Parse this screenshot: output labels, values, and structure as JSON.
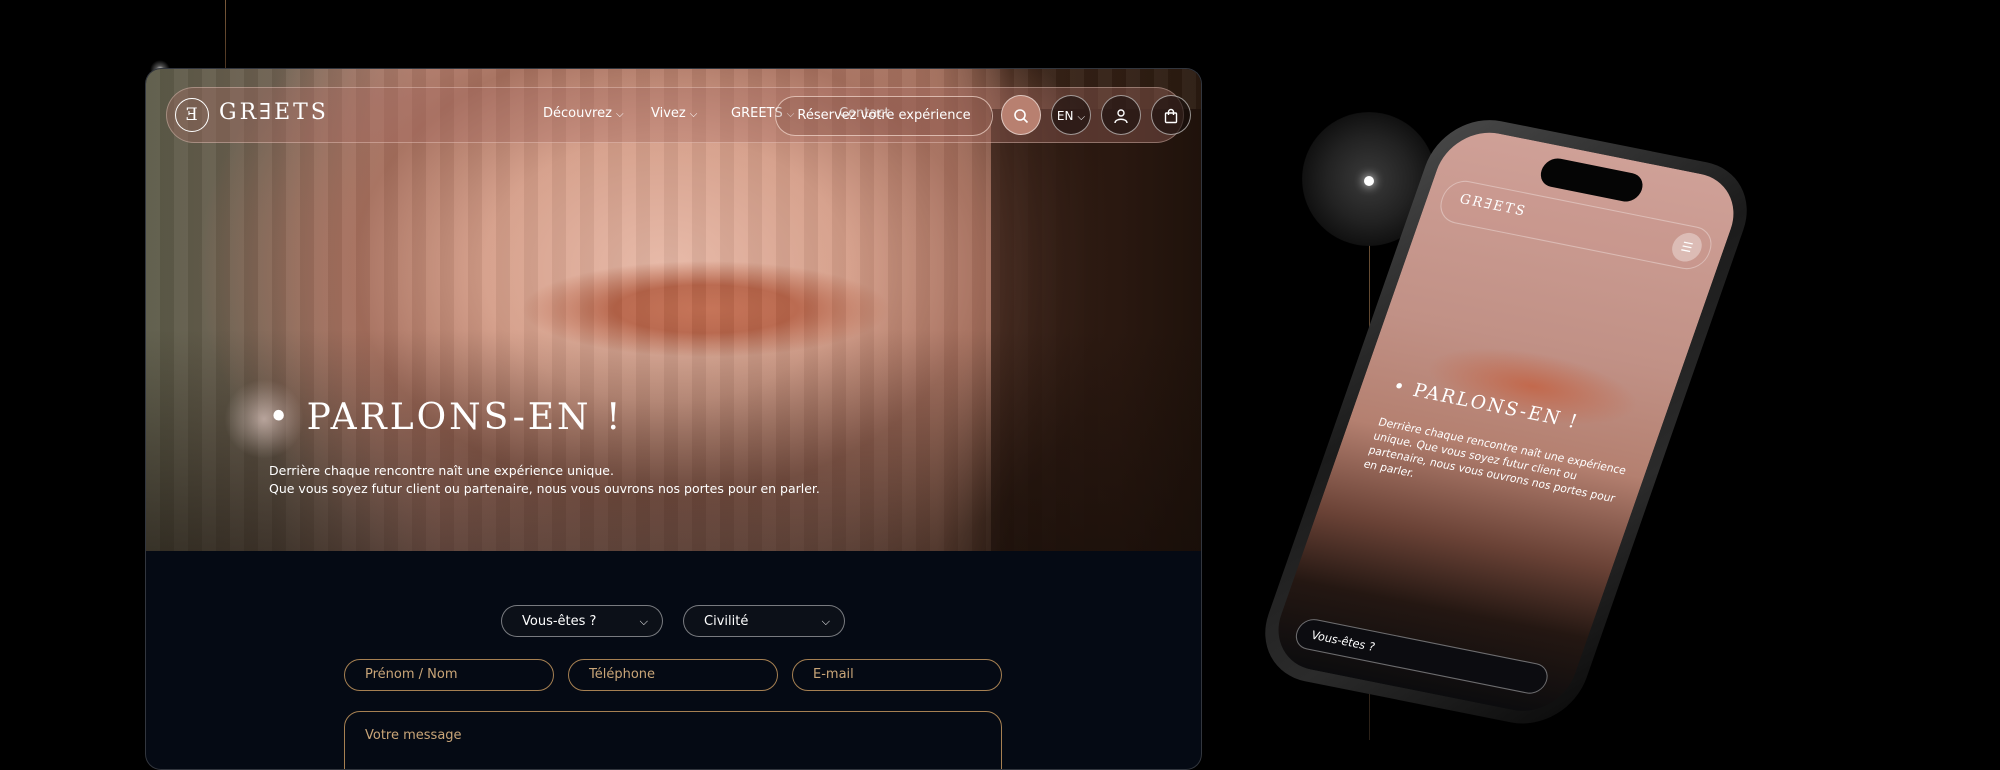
{
  "nav": {
    "logo_text": "GR∃ETS",
    "logo_mark": "Ǝ",
    "links": [
      {
        "label": "Découvrez"
      },
      {
        "label": "Vivez"
      },
      {
        "label": "GREETS"
      },
      {
        "label": "Contact"
      }
    ],
    "cta": "Réservez votre expérience",
    "lang": "EN"
  },
  "hero": {
    "title": "• PARLONS-EN !",
    "line1": "Derrière chaque rencontre naît une expérience unique.",
    "line2": "Que vous soyez futur client ou partenaire, nous vous ouvrons nos portes pour en parler."
  },
  "form": {
    "select_who": "Vous-êtes ?",
    "select_civility": "Civilité",
    "name_placeholder": "Prénom / Nom",
    "phone_placeholder": "Téléphone",
    "email_placeholder": "E-mail",
    "message_placeholder": "Votre message"
  },
  "mobile": {
    "logo_text": "GR∃ETS",
    "title": "• PARLONS-EN !",
    "desc": "Derrière chaque rencontre naît une expérience unique. Que vous soyez futur client ou partenaire, nous vous ouvrons nos portes pour en parler.",
    "select_who": "Vous-êtes ?"
  },
  "icons": {
    "chevron": "chevron-down-icon",
    "search": "search-icon",
    "user": "user-icon",
    "bag": "shopping-bag-icon",
    "menu": "hamburger-menu-icon"
  },
  "colors": {
    "background": "#000000",
    "form_background": "#050a14",
    "gold_border": "#a68052",
    "gold_text": "#c9a578"
  }
}
